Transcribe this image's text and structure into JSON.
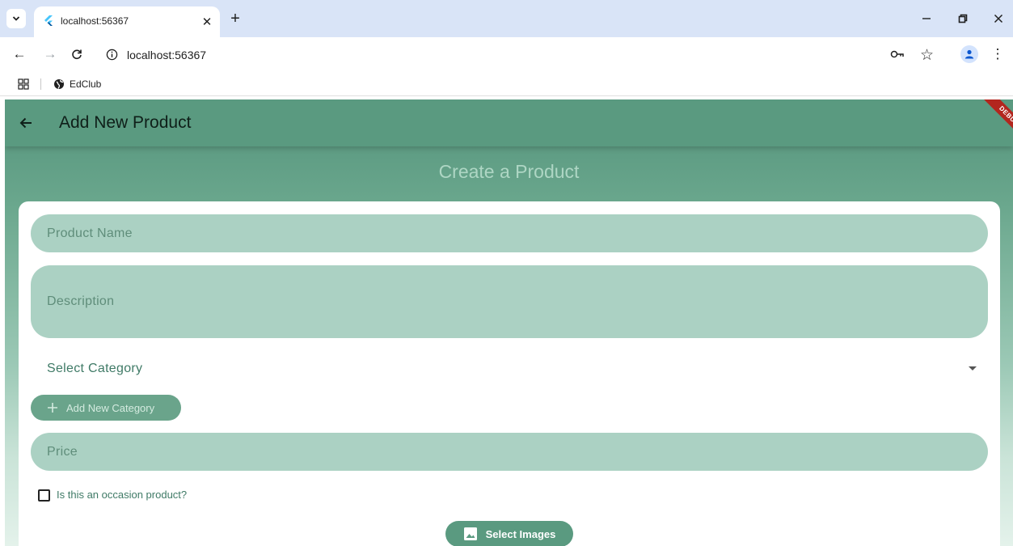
{
  "browser": {
    "tab_title": "localhost:56367",
    "url": "localhost:56367",
    "bookmark": "EdClub"
  },
  "app": {
    "title": "Add New Product",
    "debug_label": "DEBUG",
    "heading": "Create a Product",
    "form": {
      "product_name_placeholder": "Product Name",
      "description_placeholder": "Description",
      "category_placeholder": "Select Category",
      "add_category_label": "Add New Category",
      "price_placeholder": "Price",
      "occasion_label": "Is this an occasion product?",
      "occasion_checked": false,
      "select_images_label": "Select Images"
    }
  },
  "colors": {
    "primary": "#5a9a80",
    "field_fill": "#abd1c3",
    "tabstrip": "#d9e4f7"
  }
}
